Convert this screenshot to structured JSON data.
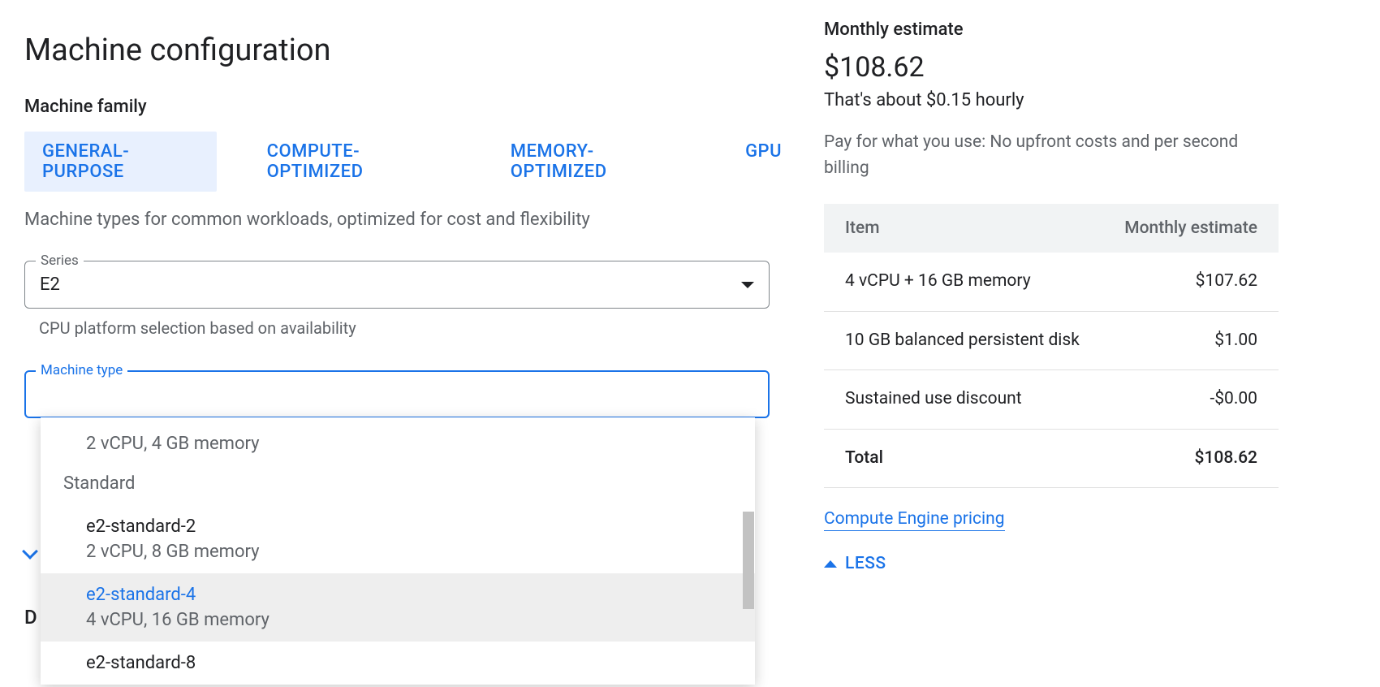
{
  "page": {
    "title": "Machine configuration"
  },
  "family": {
    "label": "Machine family",
    "tabs": [
      "GENERAL-PURPOSE",
      "COMPUTE-OPTIMIZED",
      "MEMORY-OPTIMIZED",
      "GPU"
    ],
    "active_index": 0,
    "description": "Machine types for common workloads, optimized for cost and flexibility"
  },
  "series": {
    "label": "Series",
    "value": "E2",
    "helper": "CPU platform selection based on availability"
  },
  "machine_type": {
    "label": "Machine type",
    "partial_visible_option_desc": "2 vCPU, 4 GB memory",
    "group_label": "Standard",
    "options": [
      {
        "name": "e2-standard-2",
        "desc": "2 vCPU, 8 GB memory",
        "selected": false
      },
      {
        "name": "e2-standard-4",
        "desc": "4 vCPU, 16 GB memory",
        "selected": true
      },
      {
        "name": "e2-standard-8",
        "desc": "",
        "selected": false
      }
    ]
  },
  "behind": {
    "partial_letter": "D"
  },
  "estimate": {
    "title": "Monthly estimate",
    "price": "$108.62",
    "hourly": "That's about $0.15 hourly",
    "billing_note": "Pay for what you use: No upfront costs and per second billing",
    "columns": {
      "item": "Item",
      "monthly": "Monthly estimate"
    },
    "rows": [
      {
        "item": "4 vCPU + 16 GB memory",
        "value": "$107.62",
        "discount": false
      },
      {
        "item": "10 GB balanced persistent disk",
        "value": "$1.00",
        "discount": false
      },
      {
        "item": "Sustained use discount",
        "value": "-$0.00",
        "discount": true
      }
    ],
    "total": {
      "label": "Total",
      "value": "$108.62"
    },
    "pricing_link": "Compute Engine pricing",
    "less_label": "LESS"
  }
}
